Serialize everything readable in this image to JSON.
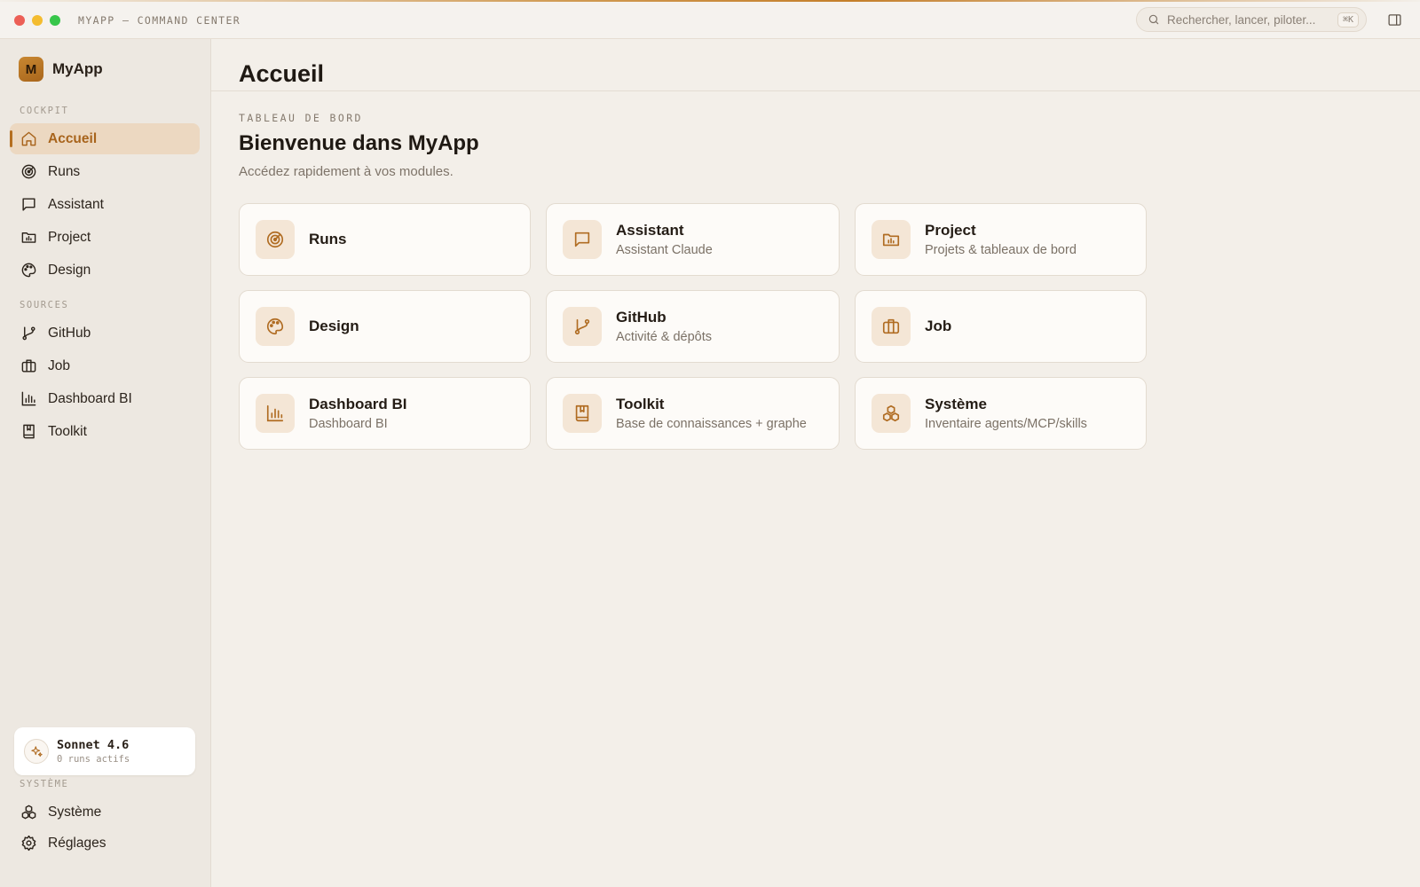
{
  "window": {
    "title": "MYAPP — COMMAND CENTER",
    "traffic_colors": [
      "#ec5f56",
      "#f4bc2f",
      "#37c64a"
    ]
  },
  "search": {
    "placeholder": "Rechercher, lancer, piloter...",
    "shortcut": "⌘K",
    "icon": "search-icon"
  },
  "brand": {
    "initial": "M",
    "name": "MyApp"
  },
  "sidebar": {
    "sections": [
      {
        "label": "COCKPIT"
      },
      {
        "label": "SOURCES"
      },
      {
        "label": "SYSTÈME"
      }
    ],
    "cockpit_items": [
      {
        "label": "Accueil",
        "icon": "home-icon",
        "active": true
      },
      {
        "label": "Runs",
        "icon": "radar-icon"
      },
      {
        "label": "Assistant",
        "icon": "message-icon"
      },
      {
        "label": "Project",
        "icon": "folder-chart-icon"
      },
      {
        "label": "Design",
        "icon": "palette-icon"
      }
    ],
    "sources_items": [
      {
        "label": "GitHub",
        "icon": "git-branch-icon"
      },
      {
        "label": "Job",
        "icon": "briefcase-icon"
      },
      {
        "label": "Dashboard BI",
        "icon": "bar-chart-icon"
      },
      {
        "label": "Toolkit",
        "icon": "book-icon"
      }
    ],
    "system_items": [
      {
        "label": "Système",
        "icon": "boxes-icon"
      },
      {
        "label": "Réglages",
        "icon": "gear-icon"
      }
    ]
  },
  "model": {
    "name": "Sonnet 4.6",
    "status": "0 runs actifs",
    "icon": "sparkles-icon"
  },
  "main": {
    "title": "Accueil",
    "eyebrow": "TABLEAU DE BORD",
    "welcome": "Bienvenue dans MyApp",
    "subtitle": "Accédez rapidement à vos modules.",
    "cards": [
      {
        "title": "Runs",
        "desc": "",
        "icon": "radar-icon"
      },
      {
        "title": "Assistant",
        "desc": "Assistant Claude",
        "icon": "message-icon"
      },
      {
        "title": "Project",
        "desc": "Projets & tableaux de bord",
        "icon": "folder-chart-icon"
      },
      {
        "title": "Design",
        "desc": "",
        "icon": "palette-icon"
      },
      {
        "title": "GitHub",
        "desc": "Activité & dépôts",
        "icon": "git-branch-icon"
      },
      {
        "title": "Job",
        "desc": "",
        "icon": "briefcase-icon"
      },
      {
        "title": "Dashboard BI",
        "desc": "Dashboard BI",
        "icon": "bar-chart-icon"
      },
      {
        "title": "Toolkit",
        "desc": "Base de connaissances + graphe",
        "icon": "book-icon"
      },
      {
        "title": "Système",
        "desc": "Inventaire agents/MCP/skills",
        "icon": "boxes-icon"
      }
    ]
  },
  "colors": {
    "accent": "#b56f20",
    "active_bg": "#ecd8c1",
    "background": "#f3efe9",
    "card_bg": "#fdfbf8"
  }
}
